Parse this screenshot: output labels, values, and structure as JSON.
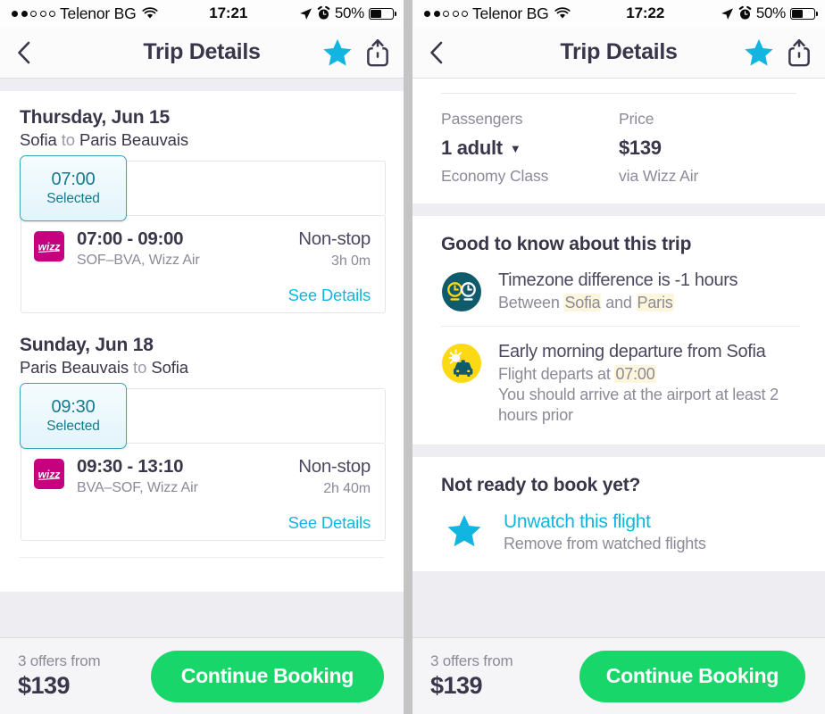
{
  "left": {
    "status": {
      "signal_dots": [
        true,
        true,
        false,
        false,
        false
      ],
      "carrier": "Telenor BG",
      "wifi_icon": "wifi-icon",
      "time": "17:21",
      "location_icon": "location-arrow-icon",
      "alarm_icon": "alarm-clock-icon",
      "battery_percent": "50%",
      "battery_level": 50
    },
    "nav": {
      "back_icon": "chevron-left-icon",
      "title": "Trip Details",
      "star_icon": "star-filled-icon",
      "share_icon": "share-icon"
    },
    "legs": [
      {
        "date": "Thursday, Jun 15",
        "from": "Sofia",
        "to_word": "to",
        "to": "Paris Beauvais",
        "chip_time": "07:00",
        "chip_status": "Selected",
        "airline_logo": "wizz-air-logo",
        "times": "07:00 - 09:00",
        "route_airline": "SOF–BVA, Wizz Air",
        "stops": "Non-stop",
        "duration": "3h 0m",
        "details_link": "See Details"
      },
      {
        "date": "Sunday, Jun 18",
        "from": "Paris Beauvais",
        "to_word": "to",
        "to": "Sofia",
        "chip_time": "09:30",
        "chip_status": "Selected",
        "airline_logo": "wizz-air-logo",
        "times": "09:30 - 13:10",
        "route_airline": "BVA–SOF, Wizz Air",
        "stops": "Non-stop",
        "duration": "2h 40m",
        "details_link": "See Details"
      }
    ],
    "footer": {
      "offers": "3 offers from",
      "price": "$139",
      "cta": "Continue Booking"
    }
  },
  "right": {
    "status": {
      "signal_dots": [
        true,
        true,
        false,
        false,
        false
      ],
      "carrier": "Telenor BG",
      "wifi_icon": "wifi-icon",
      "time": "17:22",
      "location_icon": "location-arrow-icon",
      "alarm_icon": "alarm-clock-icon",
      "battery_percent": "50%",
      "battery_level": 50
    },
    "nav": {
      "back_icon": "chevron-left-icon",
      "title": "Trip Details",
      "star_icon": "star-filled-icon",
      "share_icon": "share-icon"
    },
    "summary": {
      "passengers_label": "Passengers",
      "passengers_value": "1 adult",
      "passengers_caret": "▼",
      "cabin_class": "Economy Class",
      "price_label": "Price",
      "price_value": "$139",
      "price_note": "via Wizz Air"
    },
    "good_to_know": {
      "title": "Good to know about this trip",
      "items": [
        {
          "icon": "timezone-clocks-icon",
          "head": "Timezone difference is -1 hours",
          "sub_pre": "Between ",
          "sub_hl1": "Sofia",
          "sub_mid": " and ",
          "sub_hl2": "Paris",
          "sub_post": ""
        },
        {
          "icon": "early-morning-taxi-icon",
          "head": "Early morning departure from Sofia",
          "sub_pre": "Flight departs at ",
          "sub_hl1": "07:00",
          "sub_mid": "",
          "sub_hl2": "",
          "sub_post": "\nYou should arrive at the airport at least 2 hours prior"
        }
      ]
    },
    "not_ready": {
      "title": "Not ready to book yet?",
      "star_icon": "star-filled-icon",
      "link": "Unwatch this flight",
      "sub": "Remove from watched flights"
    },
    "footer": {
      "offers": "3 offers from",
      "price": "$139",
      "cta": "Continue Booking"
    }
  },
  "colors": {
    "accent_cyan": "#12b5e0",
    "teal": "#17798e",
    "green_cta": "#19d66b",
    "wizz_magenta": "#c6007e",
    "dark_text": "#39364a",
    "muted_text": "#8b8a97",
    "highlight_yellow": "#fdf6dd",
    "icon_teal_dark": "#0f5b6b",
    "icon_yellow": "#fbd914"
  }
}
